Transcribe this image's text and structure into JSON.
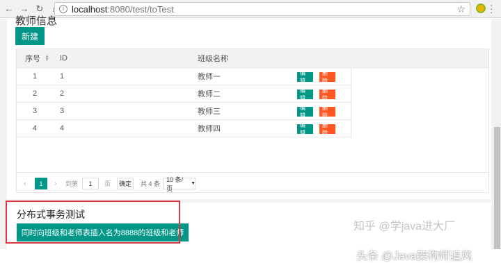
{
  "browser": {
    "url_host": "localhost",
    "url_rest": ":8080/test/toTest"
  },
  "page": {
    "cut_title": "教师信息",
    "new_button": "新建",
    "table": {
      "columns": [
        "序号",
        "ID",
        "班级名称"
      ],
      "rows": [
        {
          "no": "1",
          "id": "1",
          "name": "教师一",
          "edit": "编辑",
          "del": "删除"
        },
        {
          "no": "2",
          "id": "2",
          "name": "教师二",
          "edit": "编辑",
          "del": "删除"
        },
        {
          "no": "3",
          "id": "3",
          "name": "教师三",
          "edit": "编辑",
          "del": "删除"
        },
        {
          "no": "4",
          "id": "4",
          "name": "教师四",
          "edit": "编辑",
          "del": "删除"
        }
      ]
    },
    "pager": {
      "current": "1",
      "goto_label": "到第",
      "goto_value": "1",
      "page_label": "页",
      "ok": "确定",
      "total": "共 4 条",
      "size": "10 条/页"
    },
    "section": {
      "title": "分布式事务测试",
      "button": "同时向班级和老师表插入名为8888的班级和老师"
    },
    "watermark": {
      "faint": "知乎 @学java进大厂",
      "strong": "头条 @Java架构师追风"
    }
  },
  "colors": {
    "primary": "#009688",
    "danger": "#FF5722",
    "highlight_border": "#d9363e"
  }
}
